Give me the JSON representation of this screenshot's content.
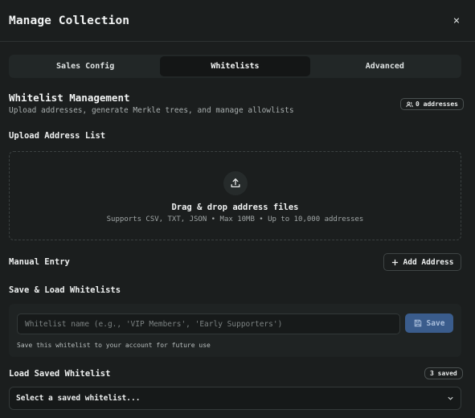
{
  "modal": {
    "title": "Manage Collection",
    "close_glyph": "×"
  },
  "tabs": [
    {
      "label": "Sales Config",
      "active": false
    },
    {
      "label": "Whitelists",
      "active": true
    },
    {
      "label": "Advanced",
      "active": false
    }
  ],
  "section": {
    "title": "Whitelist Management",
    "subtitle": "Upload addresses, generate Merkle trees, and manage allowlists",
    "address_count_label": "0 addresses"
  },
  "upload": {
    "label": "Upload Address List",
    "icon": "upload-icon",
    "title": "Drag & drop address files",
    "subtitle": "Supports CSV, TXT, JSON • Max 10MB • Up to 10,000 addresses"
  },
  "manual": {
    "label": "Manual Entry",
    "add_button_label": "Add Address",
    "add_icon": "plus-icon"
  },
  "save_load": {
    "label": "Save & Load Whitelists",
    "name_input_value": "",
    "name_input_placeholder": "Whitelist name (e.g., 'VIP Members', 'Early Supporters')",
    "save_button_label": "Save",
    "save_icon": "floppy-disk-icon",
    "hint": "Save this whitelist to your account for future use"
  },
  "load_saved": {
    "label": "Load Saved Whitelist",
    "saved_count_label": "3 saved",
    "select_value": "Select a saved whitelist..."
  },
  "colors": {
    "background": "#1b1e1e",
    "tab_active_bg": "#141616",
    "save_button_bg": "#3a5c8c"
  }
}
